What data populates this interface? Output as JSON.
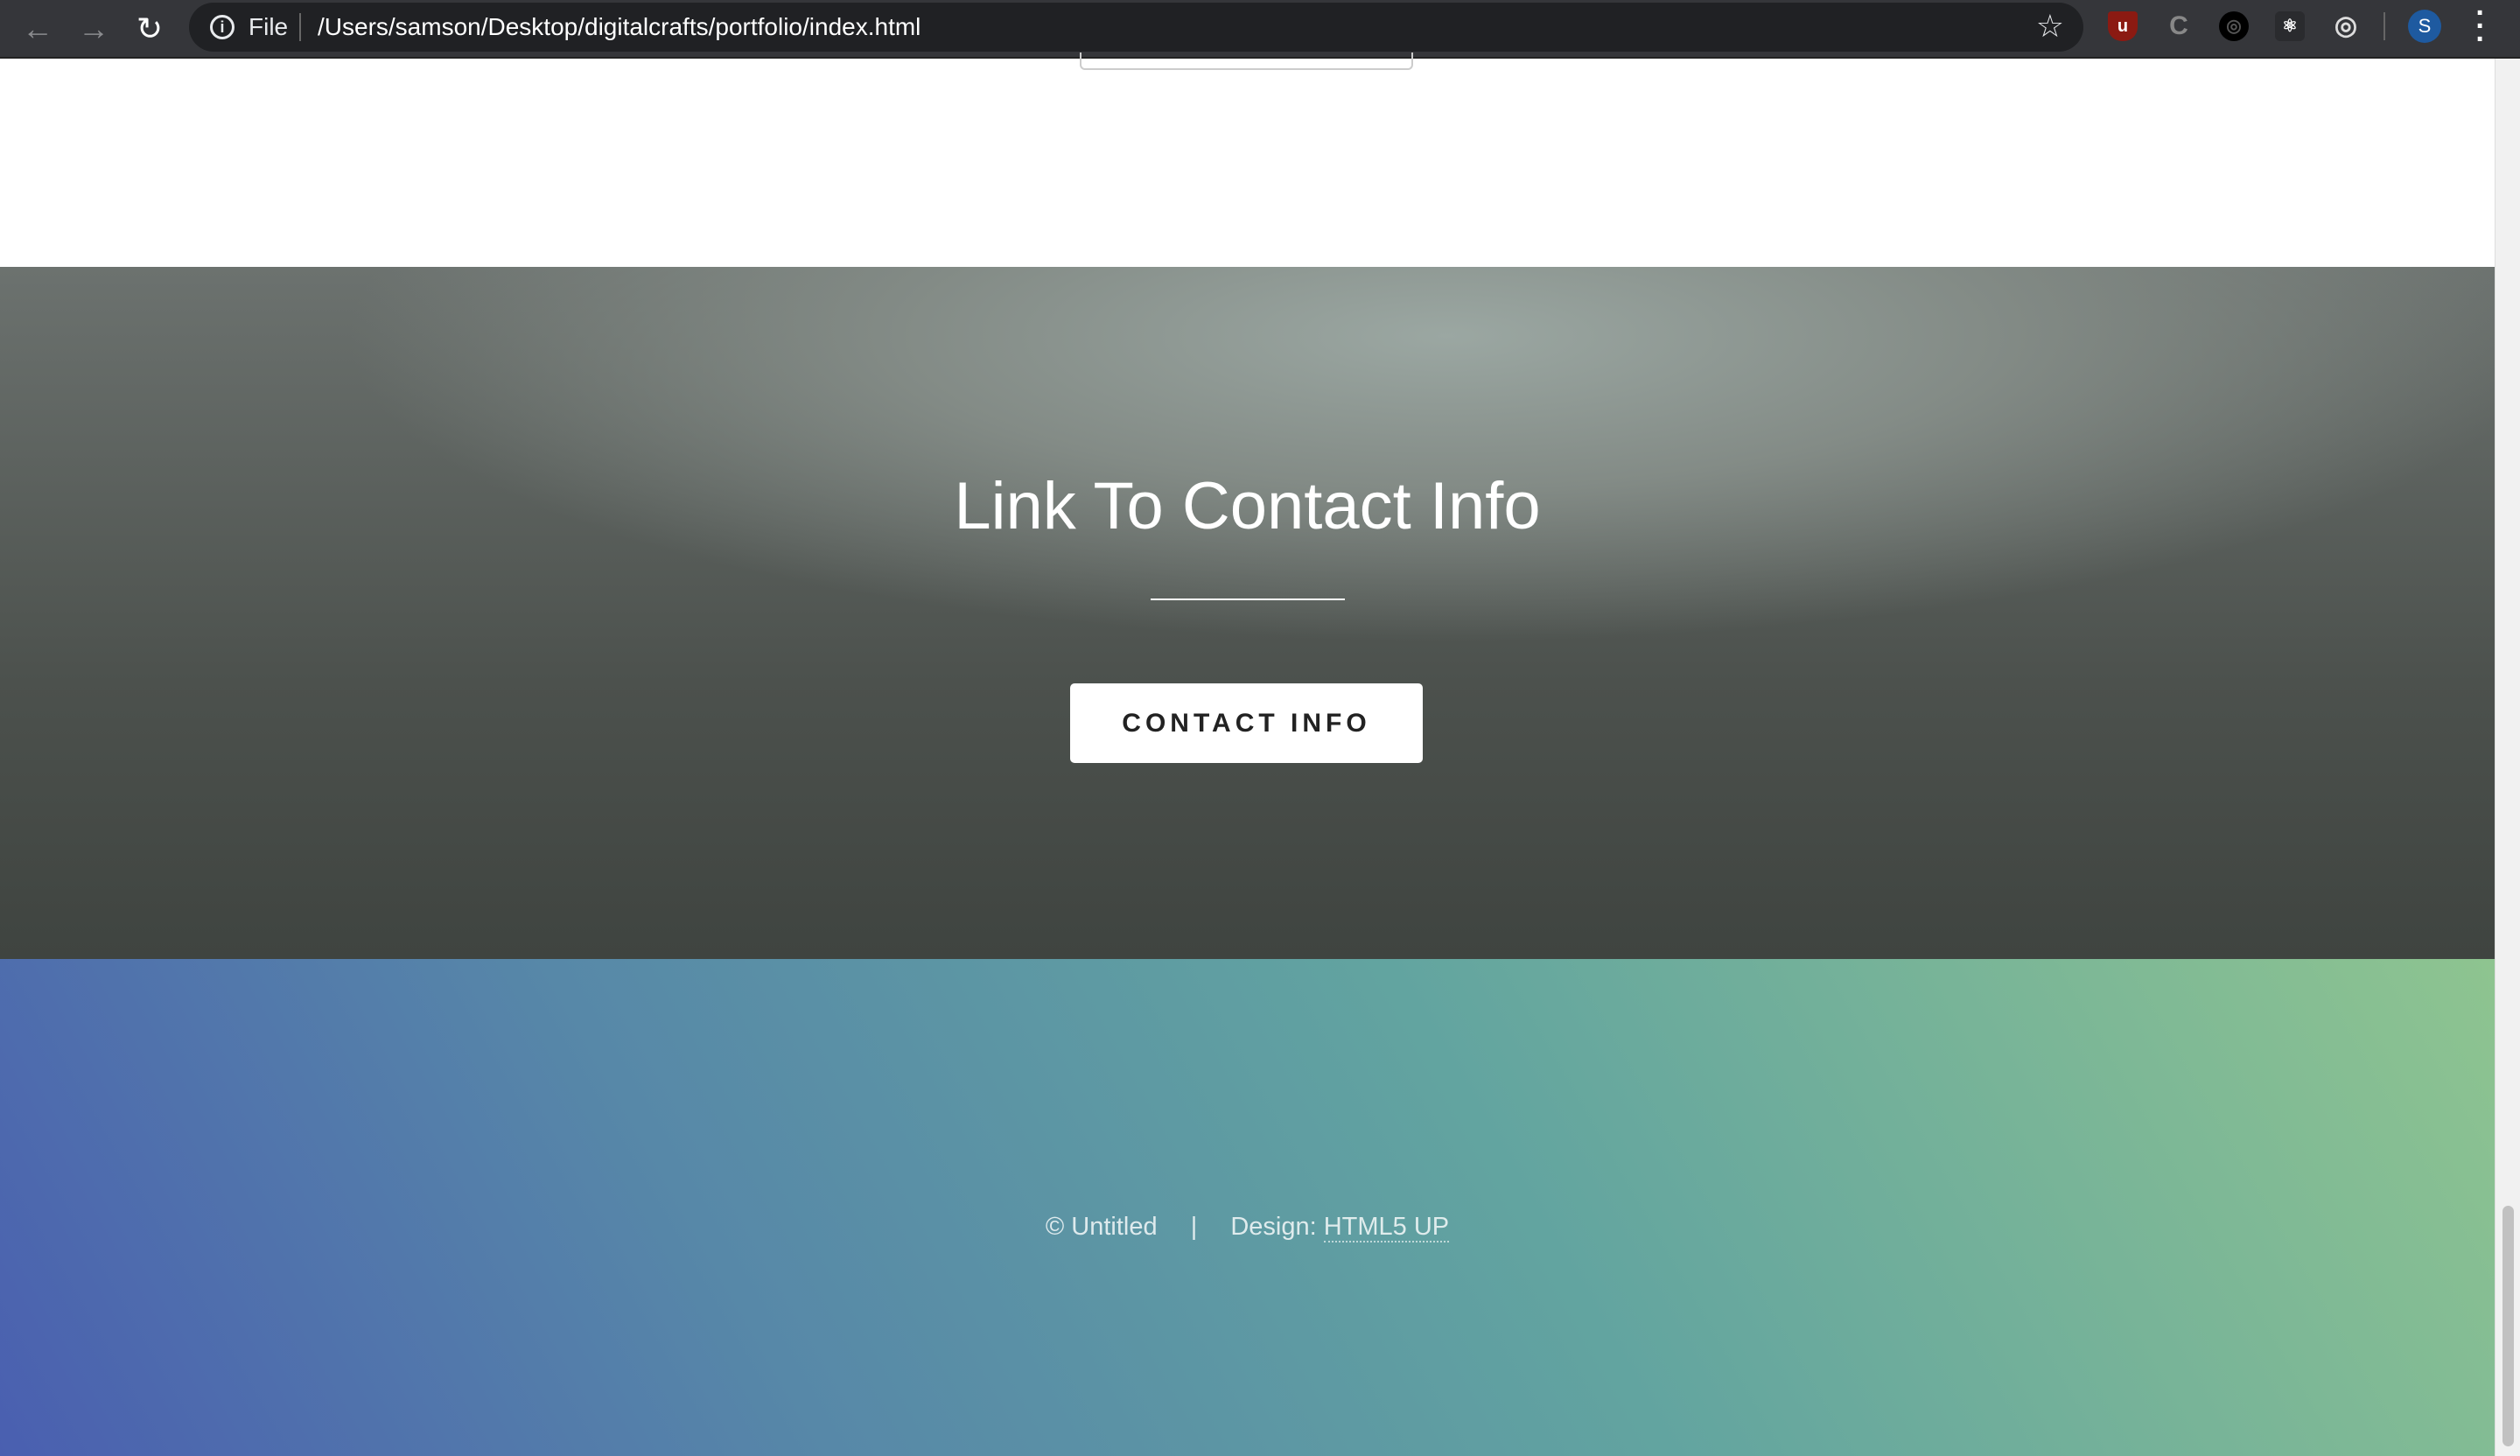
{
  "browser": {
    "url_scheme": "File",
    "url": "/Users/samson/Desktop/digitalcrafts/portfolio/index.html",
    "profile_initial": "S",
    "extensions": [
      "ublock-origin-icon",
      "clearbit-connect-icon",
      "chrome-logo-icon",
      "react-devtools-icon",
      "target-icon"
    ]
  },
  "banner": {
    "title": "Link To Contact Info",
    "button": "CONTACT INFO"
  },
  "footer": {
    "copyright": "© Untitled",
    "separator": "|",
    "design_label": "Design:",
    "design_link": "HTML5 UP"
  },
  "colors": {
    "banner": "#5a605c",
    "footer_start": "#4a5fb0",
    "footer_end": "#8ec490",
    "toolbar": "#35363a"
  }
}
